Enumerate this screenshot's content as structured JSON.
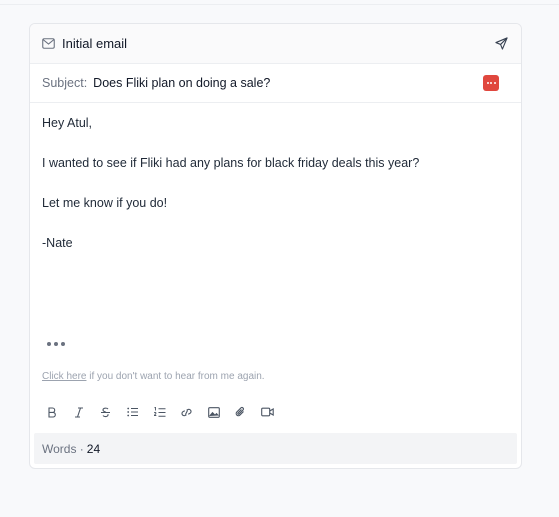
{
  "email": {
    "title": "Initial email",
    "subject_label": "Subject:",
    "subject": "Does Fliki plan on doing a sale?",
    "body": [
      "Hey Atul,",
      "I wanted to see if Fliki had any plans for black friday deals this year?",
      "Let me know if you do!",
      "-Nate"
    ],
    "unsubscribe_link": "Click here",
    "unsubscribe_text": " if you don't want to hear from me again.",
    "words_label": "Words ·",
    "word_count": "24"
  },
  "toolbar": {
    "icons": [
      "bold-icon",
      "italic-icon",
      "strikethrough-icon",
      "bullet-list-icon",
      "numbered-list-icon",
      "link-icon",
      "image-icon",
      "attachment-icon",
      "video-icon"
    ]
  },
  "colors": {
    "badge": "#e0473e",
    "text": "#1f2937",
    "muted": "#6b7280"
  }
}
